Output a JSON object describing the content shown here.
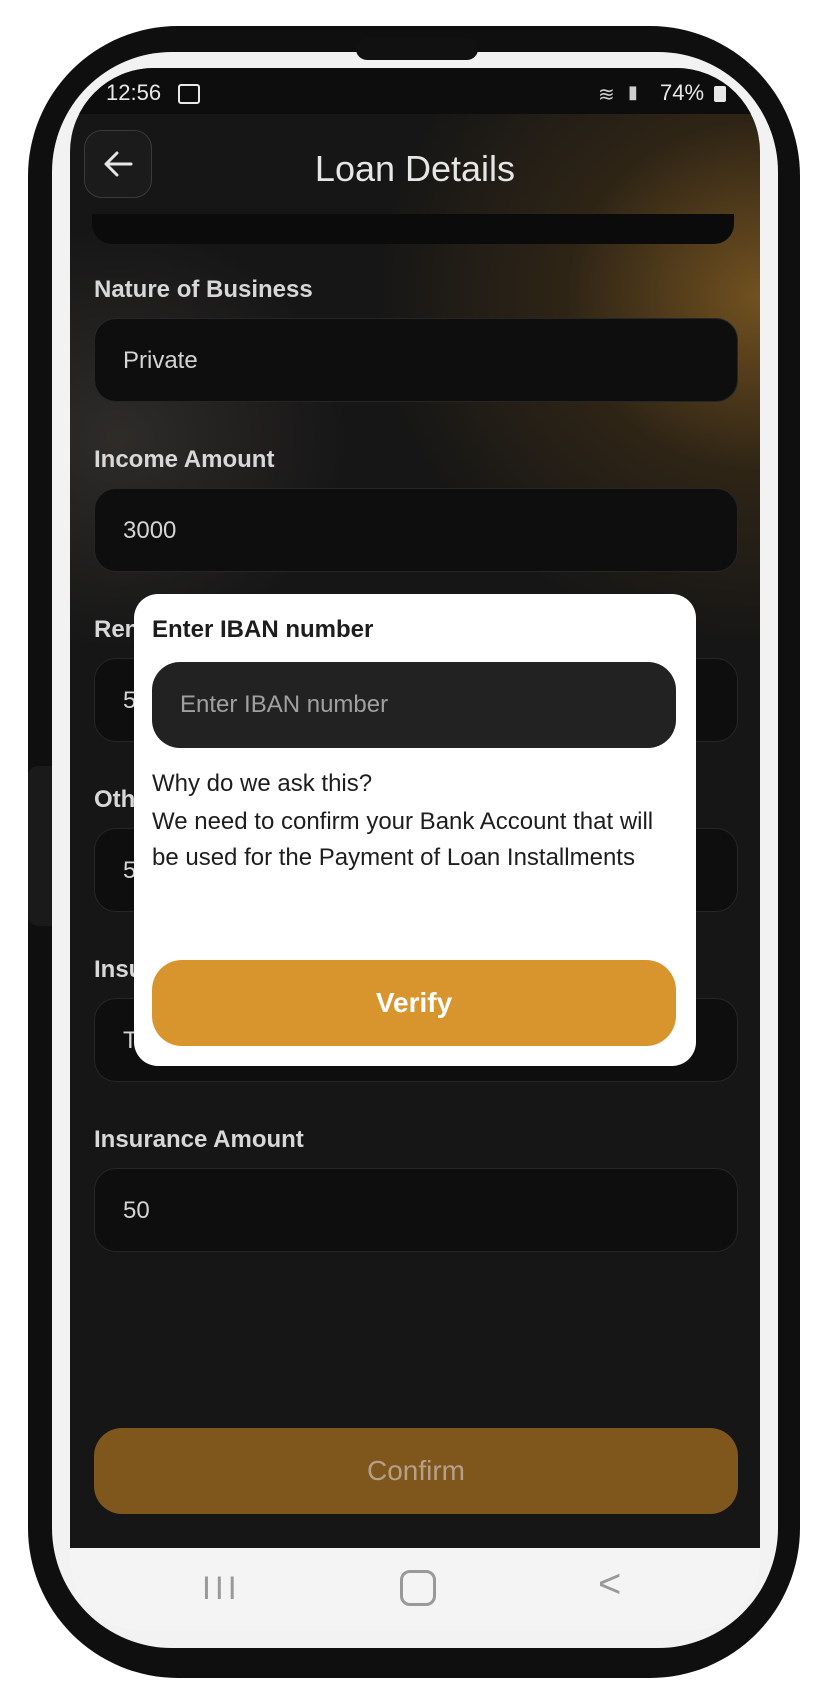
{
  "status_bar": {
    "time": "12:56",
    "battery": "74%"
  },
  "header": {
    "title": "Loan Details"
  },
  "form": {
    "fields": [
      {
        "label": "Nature of Business",
        "value": "Private"
      },
      {
        "label": "Income Amount",
        "value": "3000"
      },
      {
        "label": "Ren",
        "value": "5"
      },
      {
        "label": "Oth",
        "value": "5"
      },
      {
        "label": "Insu",
        "value": "Test"
      },
      {
        "label": "Insurance Amount",
        "value": "50"
      }
    ],
    "confirm_label": "Confirm"
  },
  "modal": {
    "title": "Enter IBAN number",
    "input_placeholder": "Enter IBAN number",
    "why_heading": "Why do we ask this?",
    "explanation": "We need to confirm your Bank Account that will be used for the Payment of Loan Installments",
    "verify_label": "Verify"
  },
  "nav": {
    "recents": "III",
    "back": "<"
  },
  "colors": {
    "accent": "#d8952e",
    "confirm_dim": "#7f561c",
    "background": "#161616",
    "field": "#0e0e0e"
  }
}
